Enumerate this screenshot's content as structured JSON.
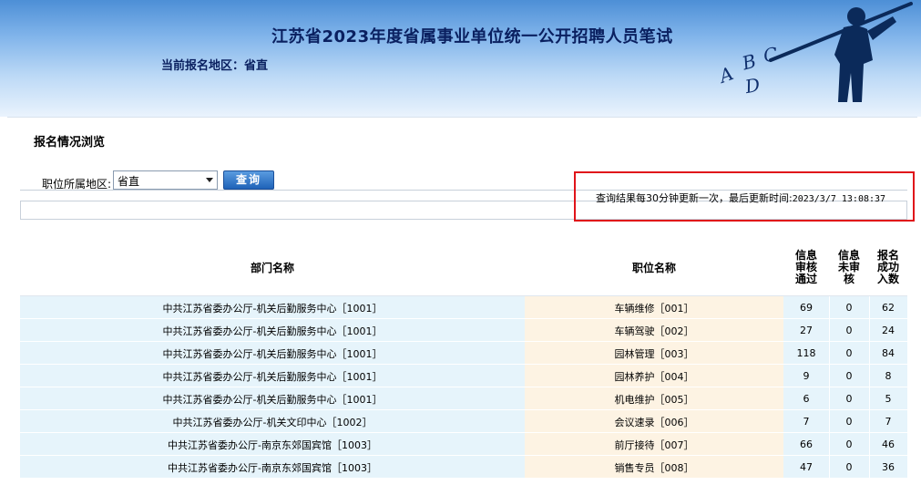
{
  "banner": {
    "title": "江苏省2023年度省属事业单位统一公开招聘人员笔试",
    "region_label": "当前报名地区：省直",
    "letters": [
      "A",
      "B",
      "C",
      "D"
    ]
  },
  "section_title": "报名情况浏览",
  "filter": {
    "label": "职位所属地区:",
    "selected": "省直",
    "button_label": "查询"
  },
  "update_note": {
    "text": "查询结果每30分钟更新一次，最后更新时间:",
    "time": "2023/3/7 13:08:37"
  },
  "table": {
    "headers": {
      "dept": "部门名称",
      "position": "职位名称",
      "approved": "信息审核通过",
      "pending": "信息未审核",
      "paid": "报名成功入数"
    },
    "rows": [
      {
        "dept": "中共江苏省委办公厅-机关后勤服务中心［1001］",
        "position": "车辆维修［001］",
        "approved": "69",
        "pending": "0",
        "paid": "62"
      },
      {
        "dept": "中共江苏省委办公厅-机关后勤服务中心［1001］",
        "position": "车辆驾驶［002］",
        "approved": "27",
        "pending": "0",
        "paid": "24"
      },
      {
        "dept": "中共江苏省委办公厅-机关后勤服务中心［1001］",
        "position": "园林管理［003］",
        "approved": "118",
        "pending": "0",
        "paid": "84"
      },
      {
        "dept": "中共江苏省委办公厅-机关后勤服务中心［1001］",
        "position": "园林养护［004］",
        "approved": "9",
        "pending": "0",
        "paid": "8"
      },
      {
        "dept": "中共江苏省委办公厅-机关后勤服务中心［1001］",
        "position": "机电维护［005］",
        "approved": "6",
        "pending": "0",
        "paid": "5"
      },
      {
        "dept": "中共江苏省委办公厅-机关文印中心［1002］",
        "position": "会议速录［006］",
        "approved": "7",
        "pending": "0",
        "paid": "7"
      },
      {
        "dept": "中共江苏省委办公厅-南京东郊国宾馆［1003］",
        "position": "前厅接待［007］",
        "approved": "66",
        "pending": "0",
        "paid": "46"
      },
      {
        "dept": "中共江苏省委办公厅-南京东郊国宾馆［1003］",
        "position": "销售专员［008］",
        "approved": "47",
        "pending": "0",
        "paid": "36"
      }
    ]
  },
  "colors": {
    "dept_bg": "#e6f4fb",
    "position_bg": "#fdf3e3",
    "highlight": "#e0141a",
    "button": "#1e62b8"
  }
}
